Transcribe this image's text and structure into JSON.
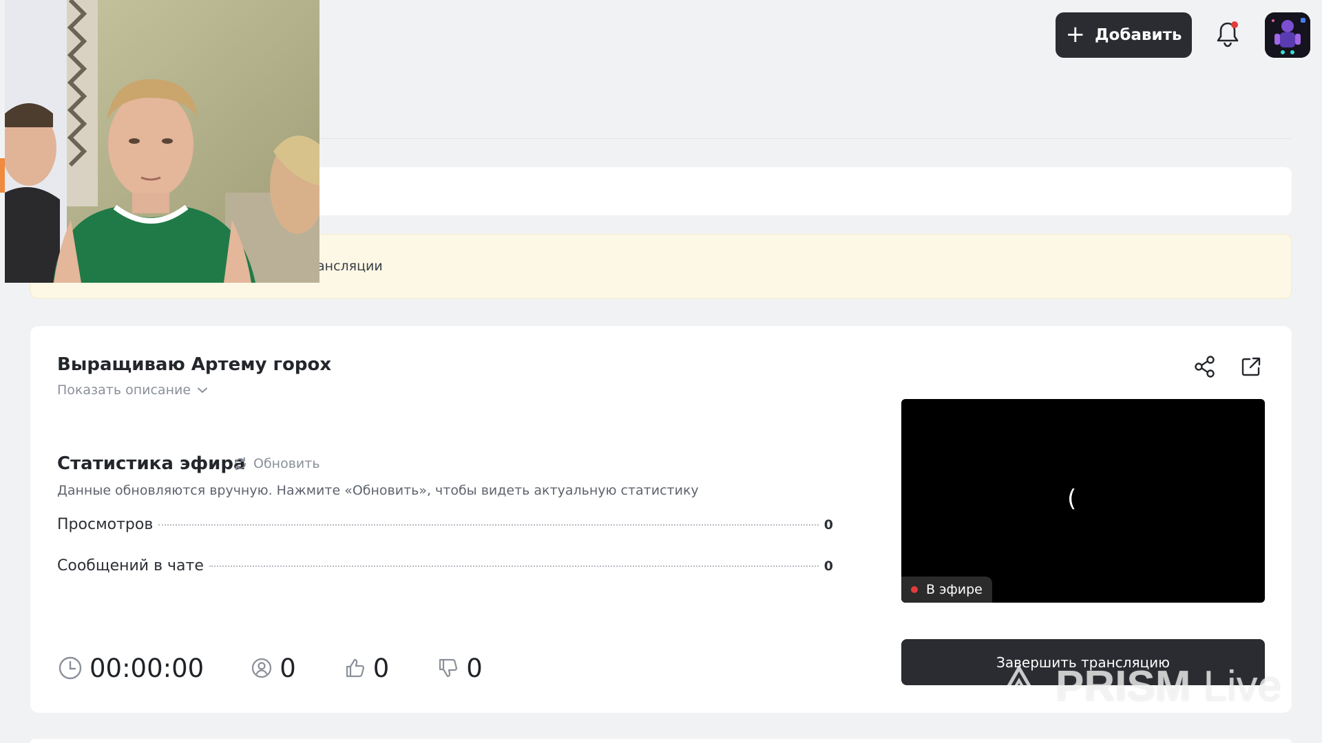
{
  "header": {
    "add_label": "Добавить",
    "notification_dot_color": "#e23b3b"
  },
  "notice": {
    "text_fragment": "ансляции"
  },
  "stream": {
    "title": "Выращиваю Артему горох",
    "show_description_label": "Показать описание"
  },
  "stats": {
    "title": "Статистика эфира",
    "refresh_label": "Обновить",
    "note": "Данные обновляются вручную. Нажмите «Обновить», чтобы видеть актуальную статистику",
    "rows": [
      {
        "label": "Просмотров",
        "value": "0"
      },
      {
        "label": "Сообщений в чате",
        "value": "0"
      }
    ]
  },
  "counters": {
    "duration": "00:00:00",
    "viewers": "0",
    "likes": "0",
    "dislikes": "0"
  },
  "preview": {
    "spinner_glyph": "(",
    "live_label": "В эфире"
  },
  "end_button_label": "Завершить трансляцию",
  "watermark": {
    "brand": "PRISM",
    "suffix": "Live"
  },
  "colors": {
    "page_bg": "#f1f2f4",
    "dark_button": "#2a2c31",
    "notice_bg": "#fdf8e6",
    "live_dot": "#e23b3b"
  }
}
